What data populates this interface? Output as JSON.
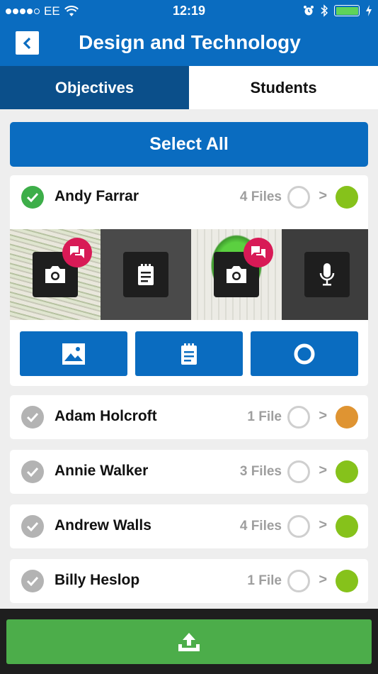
{
  "status_bar": {
    "carrier": "EE",
    "time": "12:19"
  },
  "header": {
    "title": "Design and Technology"
  },
  "tabs": [
    {
      "label": "Objectives",
      "active": true
    },
    {
      "label": "Students",
      "active": false
    }
  ],
  "select_all_label": "Select All",
  "students": [
    {
      "name": "Andy Farrar",
      "files": "4 Files",
      "checked": true,
      "status_color": "#86c21b"
    },
    {
      "name": "Adam Holcroft",
      "files": "1 File",
      "checked": false,
      "status_color": "#df9432"
    },
    {
      "name": "Annie Walker",
      "files": "3 Files",
      "checked": false,
      "status_color": "#86c21b"
    },
    {
      "name": "Andrew Walls",
      "files": "4 Files",
      "checked": false,
      "status_color": "#86c21b"
    },
    {
      "name": "Billy Heslop",
      "files": "1 File",
      "checked": false,
      "status_color": "#86c21b"
    }
  ],
  "arrow_glyph": ">",
  "media": [
    {
      "type": "photo",
      "icon": "camera-icon",
      "has_comment": true
    },
    {
      "type": "note",
      "icon": "notepad-icon",
      "has_comment": false
    },
    {
      "type": "photo",
      "icon": "camera-icon",
      "has_comment": true
    },
    {
      "type": "audio",
      "icon": "microphone-icon",
      "has_comment": false
    }
  ],
  "actions": [
    "image-icon",
    "notepad-icon",
    "ring-icon"
  ],
  "colors": {
    "primary": "#0a6cc0",
    "tab_active": "#0b4f8a",
    "check_green": "#3dae49",
    "upload_green": "#4cad4a",
    "comment_badge": "#d81a56"
  }
}
